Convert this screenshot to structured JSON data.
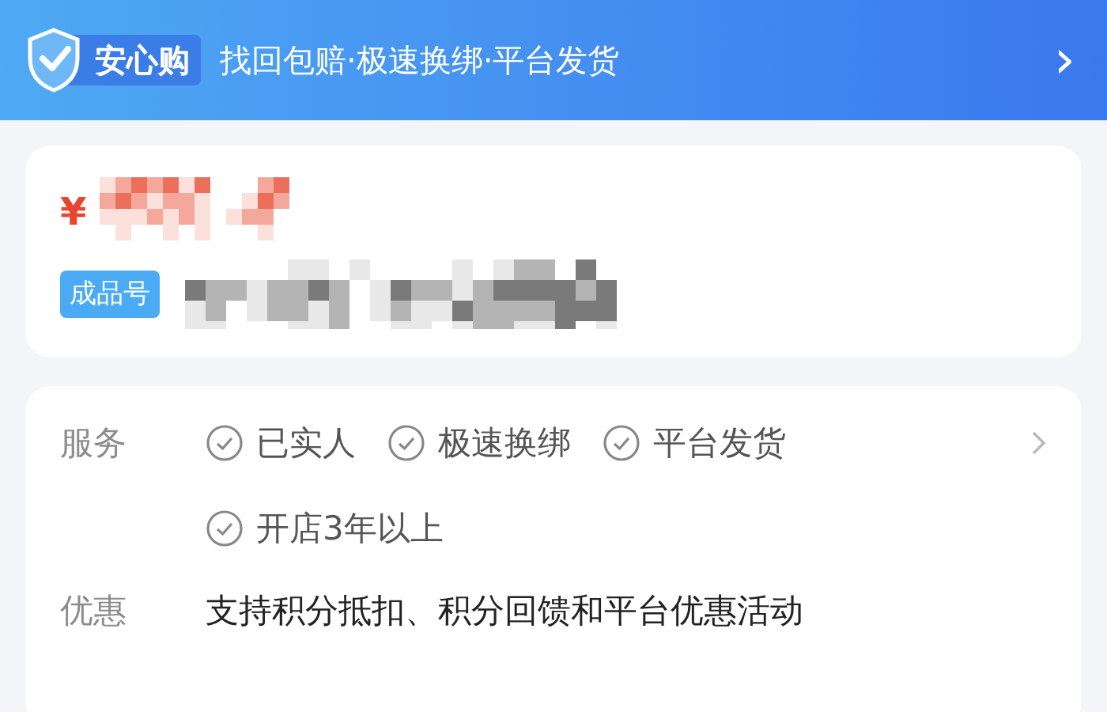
{
  "banner": {
    "badge": "安心购",
    "tagline": "找回包赔·极速换绑·平台发货",
    "chevron": "›"
  },
  "product": {
    "currency": "¥",
    "tag": "成品号"
  },
  "details": [
    {
      "label": "服务",
      "kind": "services",
      "items": [
        "已实人",
        "极速换绑",
        "平台发货",
        "开店3年以上"
      ]
    },
    {
      "label": "优惠",
      "kind": "text",
      "text": "支持积分抵扣、积分回馈和平台优惠活动"
    }
  ]
}
